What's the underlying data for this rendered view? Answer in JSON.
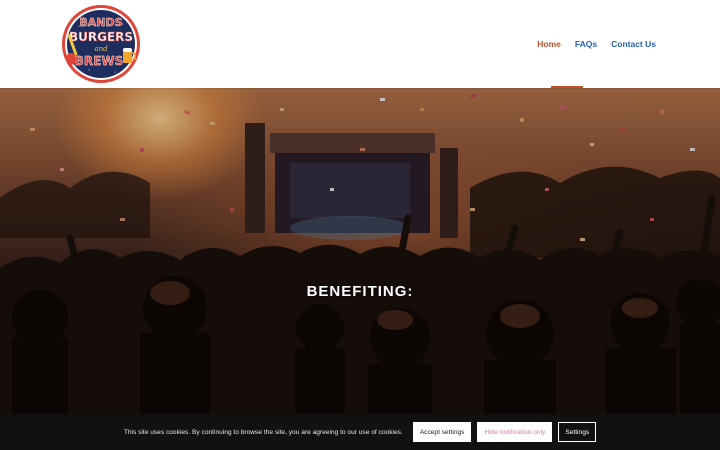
{
  "header": {
    "logo": {
      "line1": "BANDS",
      "line2": "BURGERS",
      "line3": "and",
      "line4": "BREWS"
    },
    "nav": {
      "home": "Home",
      "faqs": "FAQs",
      "contact": "Contact Us",
      "active": "home"
    }
  },
  "hero": {
    "title": "BENEFITING:"
  },
  "cookie": {
    "message": "This site uses cookies. By continuing to browse the site, you are agreeing to our use of cookies.",
    "accept": "Accept settings",
    "hide": "Hide notification only",
    "settings": "Settings"
  },
  "colors": {
    "nav_link": "#2563b0",
    "nav_active": "#c2502a",
    "cookie_bg": "#111111",
    "hide_text": "#e27ab0",
    "logo_ring": "#e0453a",
    "logo_navy": "#1d2d5e"
  }
}
